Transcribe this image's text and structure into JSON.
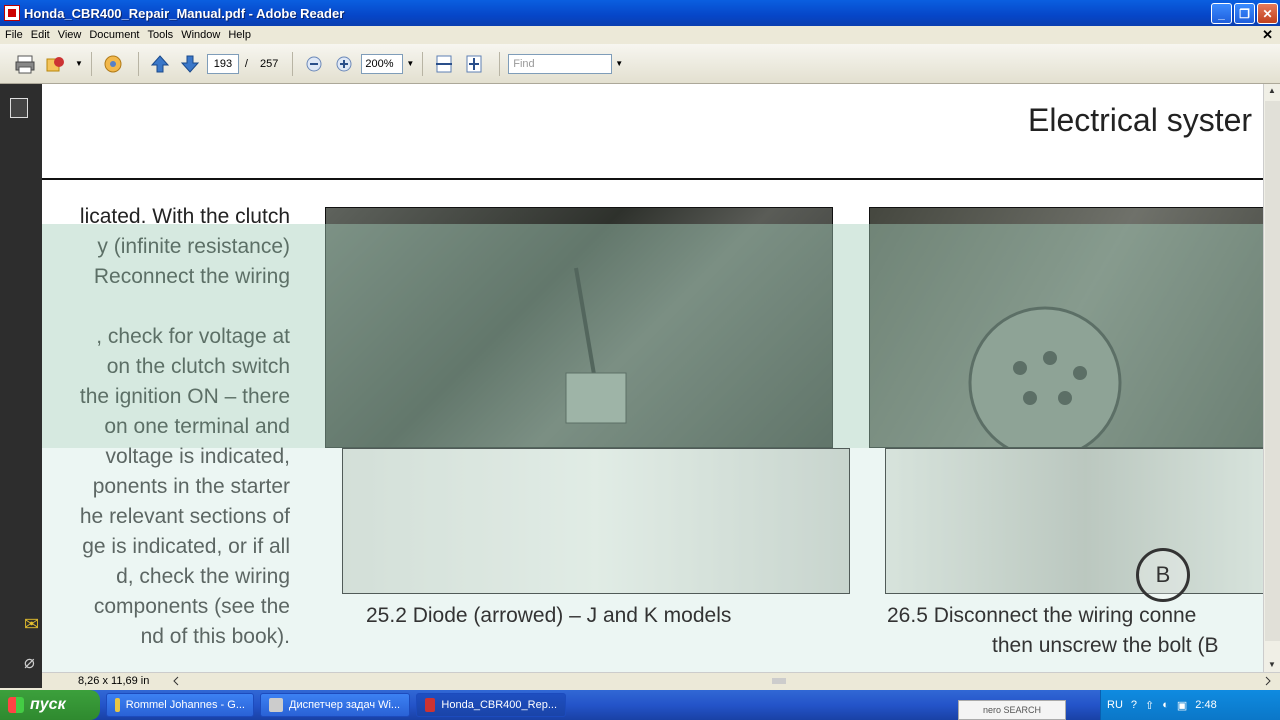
{
  "window": {
    "title": "Honda_CBR400_Repair_Manual.pdf - Adobe Reader"
  },
  "menu": [
    "File",
    "Edit",
    "View",
    "Document",
    "Tools",
    "Window",
    "Help"
  ],
  "toolbar": {
    "page_current": "193",
    "page_sep": "/",
    "page_total": "257",
    "zoom": "200%",
    "find_placeholder": "Find"
  },
  "document": {
    "heading": "Electrical syster",
    "body_lines": [
      "licated. With the clutch",
      "y (infinite resistance)",
      "Reconnect the wiring",
      "",
      ", check for voltage at",
      "on the clutch switch",
      "the ignition ON – there",
      "on one terminal and",
      "voltage is indicated,",
      "ponents in the starter",
      "he relevant sections of",
      "ge is indicated, or if all",
      "d, check the wiring",
      "components (see the",
      "nd of this book)."
    ],
    "caption1": "25.2  Diode (arrowed) – J and K models",
    "caption2a": "26.5  Disconnect the wiring conne",
    "caption2b": "then unscrew the bolt (B",
    "marker": "B"
  },
  "status": {
    "page_size": "8,26 x 11,69 in"
  },
  "taskbar": {
    "start": "пуск",
    "tasks": [
      "Rommel Johannes - G...",
      "Диспетчер задач Wi...",
      "Honda_CBR400_Rep..."
    ],
    "lang": "RU",
    "clock": "2:48",
    "nero": "nero SEARCH"
  }
}
